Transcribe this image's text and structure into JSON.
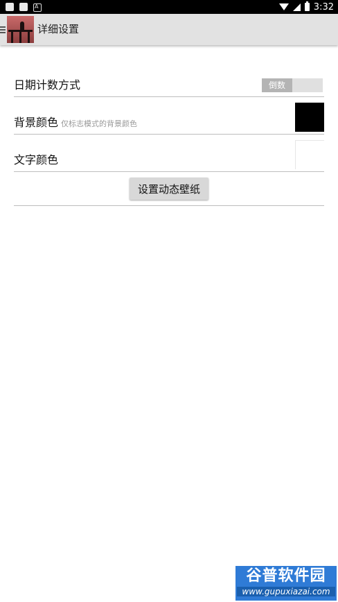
{
  "status_bar": {
    "time": "3:32"
  },
  "app_bar": {
    "title": "详细设置"
  },
  "settings": {
    "date_count": {
      "label": "日期计数方式",
      "toggle_value": "倒数"
    },
    "background_color": {
      "label": "背景颜色",
      "sublabel": "仅标志模式的背景颜色",
      "color": "#000000"
    },
    "text_color": {
      "label": "文字颜色",
      "color": "#ffffff"
    }
  },
  "wallpaper_button": {
    "label": "设置动态壁纸"
  },
  "watermark": {
    "title": "谷普软件园",
    "url": "www.gupuxiazai.com"
  }
}
